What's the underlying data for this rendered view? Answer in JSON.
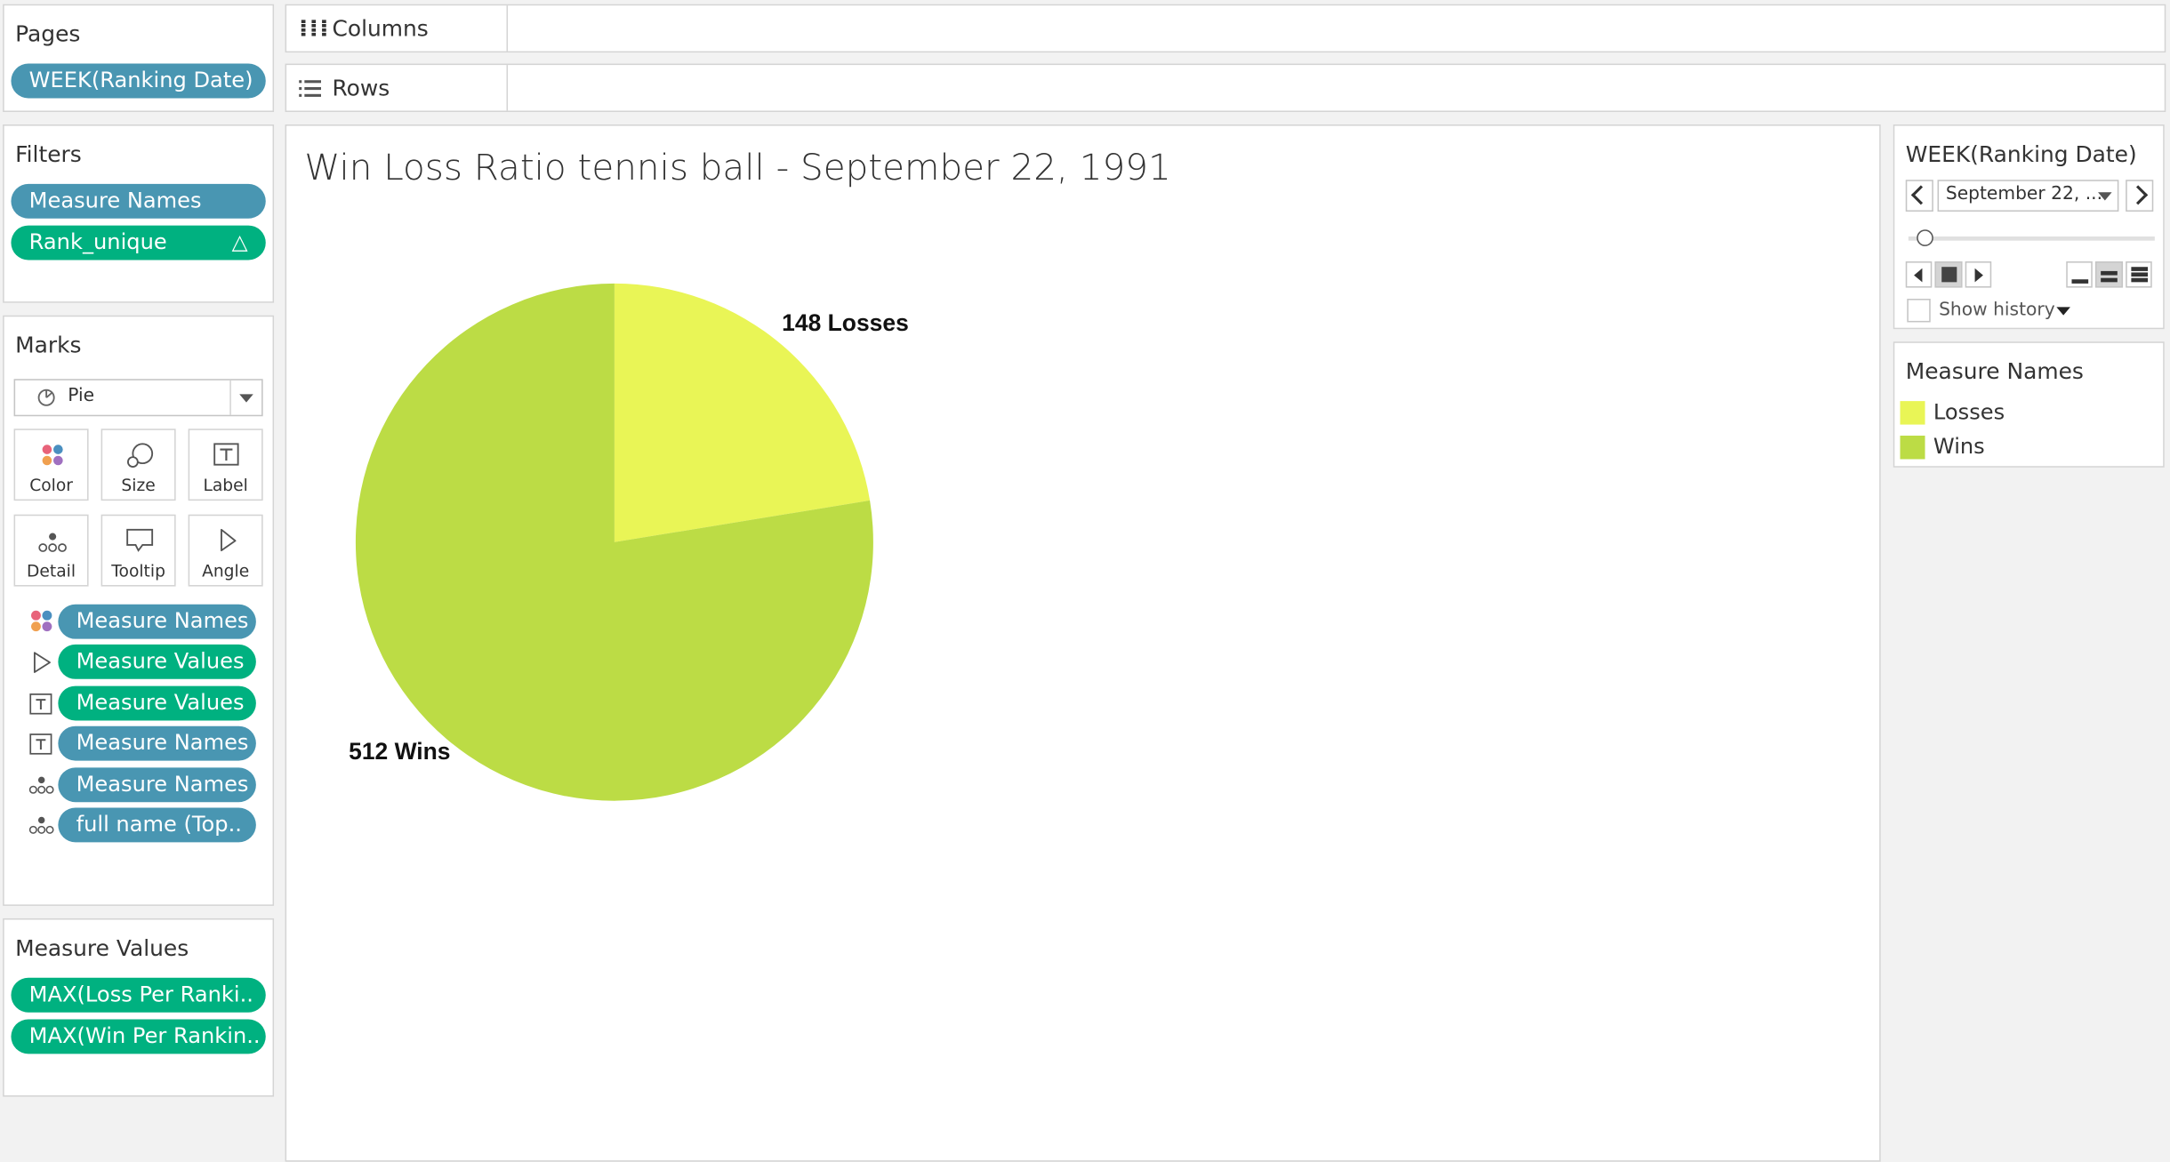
{
  "pages": {
    "title": "Pages",
    "pill": "WEEK(Ranking Date)"
  },
  "columns": {
    "label": "Columns"
  },
  "rows": {
    "label": "Rows"
  },
  "filters": {
    "title": "Filters",
    "pills": [
      "Measure Names",
      "Rank_unique"
    ]
  },
  "marks": {
    "title": "Marks",
    "type": "Pie",
    "buttons": [
      "Color",
      "Size",
      "Label",
      "Detail",
      "Tooltip",
      "Angle"
    ],
    "fields": [
      "Measure Names",
      "Measure Values",
      "Measure Values",
      "Measure Names",
      "Measure Names",
      "full name (Top.."
    ]
  },
  "measure_values": {
    "title": "Measure Values",
    "pills": [
      "MAX(Loss Per Ranki..",
      "MAX(Win Per Rankin.."
    ]
  },
  "view": {
    "title": "Win Loss Ratio tennis ball - September 22, 1991"
  },
  "page_control": {
    "title": "WEEK(Ranking Date)",
    "value": "September 22, ...",
    "show_history": "Show history"
  },
  "legend": {
    "title": "Measure Names",
    "items": [
      "Losses",
      "Wins"
    ]
  },
  "colors": {
    "losses": "#e9f556",
    "wins": "#bcdc45",
    "blue_pill": "#4996b2",
    "green_pill": "#00b180"
  },
  "chart_data": {
    "type": "pie",
    "title": "Win Loss Ratio tennis ball - September 22, 1991",
    "categories": [
      "Losses",
      "Wins"
    ],
    "values": [
      148,
      512
    ],
    "labels": [
      "148 Losses",
      "512 Wins"
    ],
    "colors": [
      "#e9f556",
      "#bcdc45"
    ]
  }
}
